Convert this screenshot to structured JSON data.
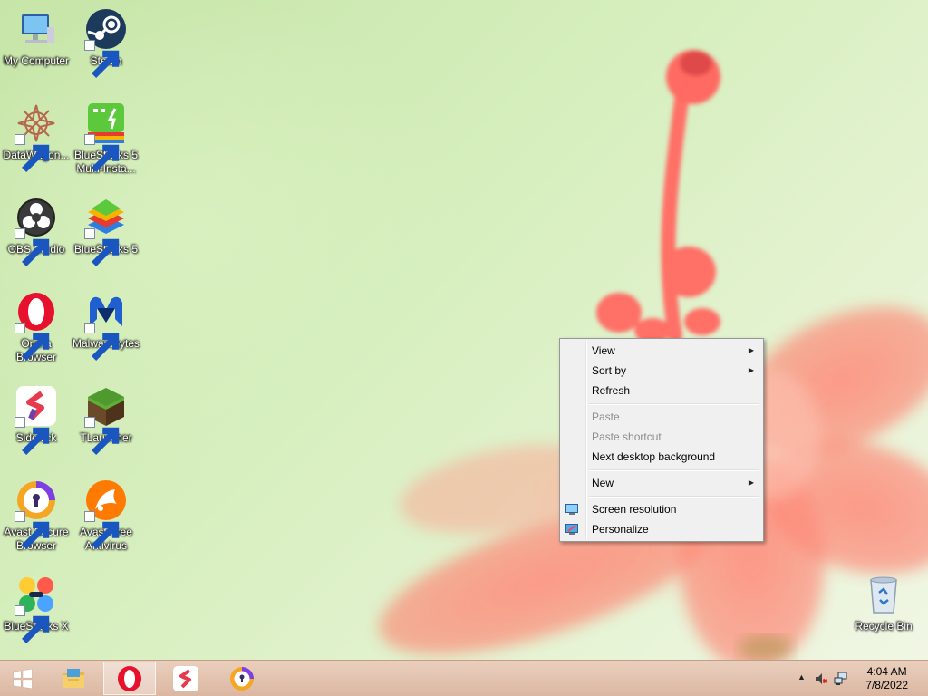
{
  "desktop_icons": [
    {
      "label": "My Computer",
      "icon": "computer-icon"
    },
    {
      "label": "Steam",
      "icon": "steam-icon"
    },
    {
      "label": "DataWagon...",
      "icon": "datawagon-icon"
    },
    {
      "label": "BlueStacks 5 Multi-Insta...",
      "icon": "bluestacks-multi-icon"
    },
    {
      "label": "OBS Studio",
      "icon": "obs-icon"
    },
    {
      "label": "BlueStacks 5",
      "icon": "bluestacks-icon"
    },
    {
      "label": "Opera Browser",
      "icon": "opera-icon"
    },
    {
      "label": "Malwarebytes",
      "icon": "malwarebytes-icon"
    },
    {
      "label": "Sidekick",
      "icon": "sidekick-icon"
    },
    {
      "label": "TLauncher",
      "icon": "tlauncher-icon"
    },
    {
      "label": "Avast Secure Browser",
      "icon": "avast-secure-browser-icon"
    },
    {
      "label": "Avast Free Antivirus",
      "icon": "avast-antivirus-icon"
    },
    {
      "label": "BlueStacks X",
      "icon": "bluestacks-x-icon"
    },
    {
      "label": "Recycle Bin",
      "icon": "recycle-bin-icon"
    }
  ],
  "context_menu": {
    "view": "View",
    "sort_by": "Sort by",
    "refresh": "Refresh",
    "paste": "Paste",
    "paste_shortcut": "Paste shortcut",
    "next_background": "Next desktop background",
    "new": "New",
    "screen_resolution": "Screen resolution",
    "personalize": "Personalize"
  },
  "taskbar": {
    "pinned": [
      "windows-start-icon",
      "file-explorer-icon",
      "opera-icon",
      "sidekick-icon",
      "avast-secure-browser-icon"
    ],
    "tray": {
      "icons": [
        "show-hidden-icons-icon",
        "volume-muted-icon",
        "network-icon"
      ],
      "time": "4:04 AM",
      "date": "7/8/2022"
    }
  },
  "colors": {
    "taskbar_bg": "#dfbea9",
    "menu_bg": "#f0f0f0",
    "disabled_text": "#8d8d8d"
  }
}
